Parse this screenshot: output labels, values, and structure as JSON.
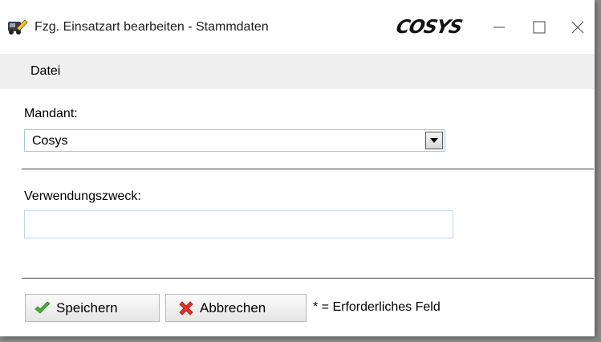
{
  "window": {
    "title": "Fzg. Einsatzart bearbeiten - Stammdaten",
    "brand": "COSYS",
    "app_icon": "vehicle-edit-icon",
    "controls": [
      "minimize-icon",
      "maximize-icon",
      "close-icon"
    ]
  },
  "menu": {
    "items": [
      {
        "label": "Datei"
      }
    ]
  },
  "form": {
    "mandant": {
      "label": "Mandant:",
      "selected": "Cosys"
    },
    "verwendungszweck": {
      "label": "Verwendungszweck:",
      "value": ""
    }
  },
  "buttons": {
    "save": {
      "label": "Speichern",
      "icon": "checkmark-icon"
    },
    "cancel": {
      "label": "Abbrechen",
      "icon": "cross-icon"
    }
  },
  "hint": "* = Erforderliches Feld",
  "colors": {
    "checkmark": "#4caf3c",
    "cross": "#e0342a"
  }
}
